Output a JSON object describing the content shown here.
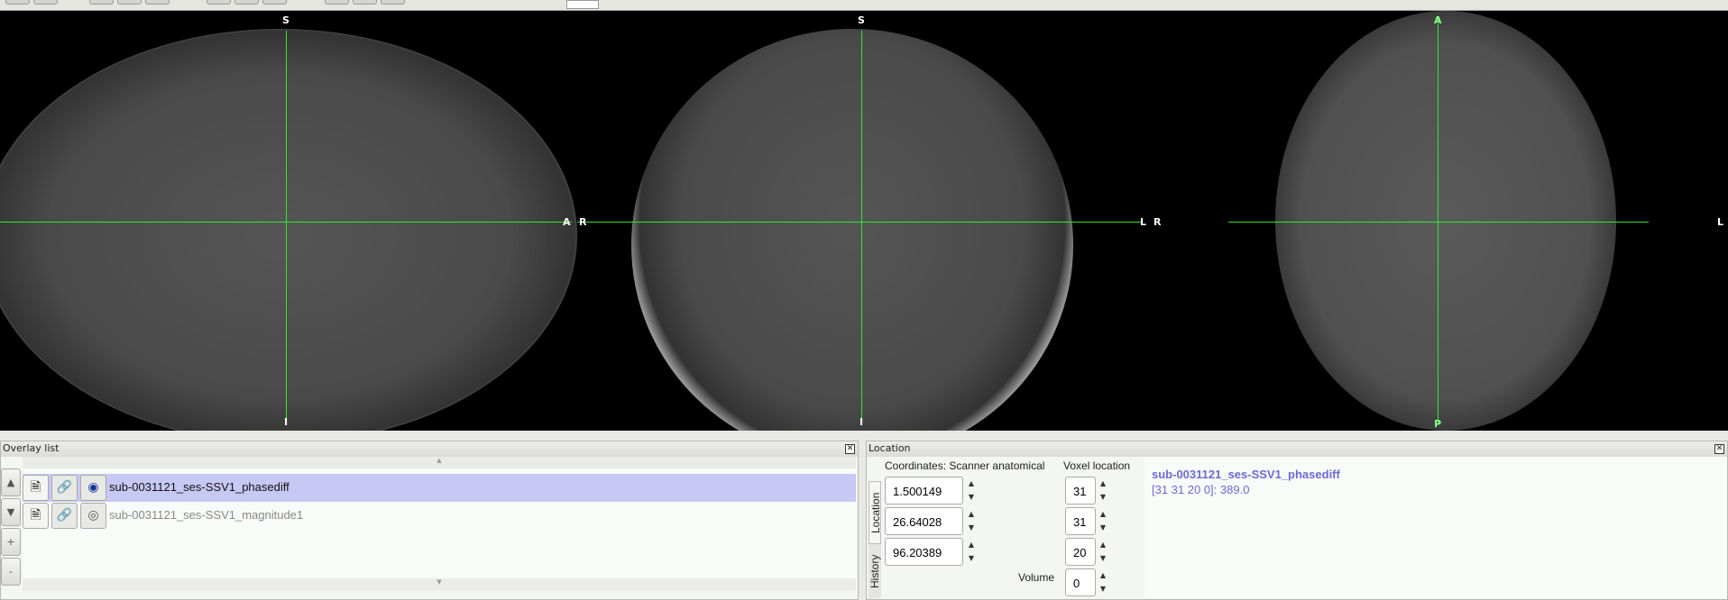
{
  "views": {
    "sagittal": {
      "top": "S",
      "bottom": "I",
      "right": "A"
    },
    "coronal": {
      "top": "S",
      "bottom": "I",
      "left": "R",
      "right": "L"
    },
    "axial": {
      "top": "A",
      "bottom": "P",
      "left": "R",
      "right": "L"
    }
  },
  "crosshair_color": "#2ee82e",
  "overlay_list": {
    "title": "Overlay list",
    "side_buttons": [
      "▲",
      "▼",
      "+",
      "-"
    ],
    "items": [
      {
        "name": "sub-0031121_ses-SSV1_phasediff",
        "selected": true,
        "visible": true
      },
      {
        "name": "sub-0031121_ses-SSV1_magnitude1",
        "selected": false,
        "visible": false
      }
    ],
    "selected_color": "#c8c8f5"
  },
  "location": {
    "title": "Location",
    "tabs": [
      "Location",
      "History"
    ],
    "coord_label": "Coordinates: Scanner anatomical",
    "voxel_label": "Voxel location",
    "coords": [
      "1.500149",
      "26.64028",
      "96.20389"
    ],
    "voxels": [
      "31",
      "31",
      "20"
    ],
    "volume_label": "Volume",
    "volume": "0",
    "info_name": "sub-0031121_ses-SSV1_phasediff",
    "info_value": "[31 31 20 0]: 389.0",
    "info_color": "#6a6ad8"
  }
}
